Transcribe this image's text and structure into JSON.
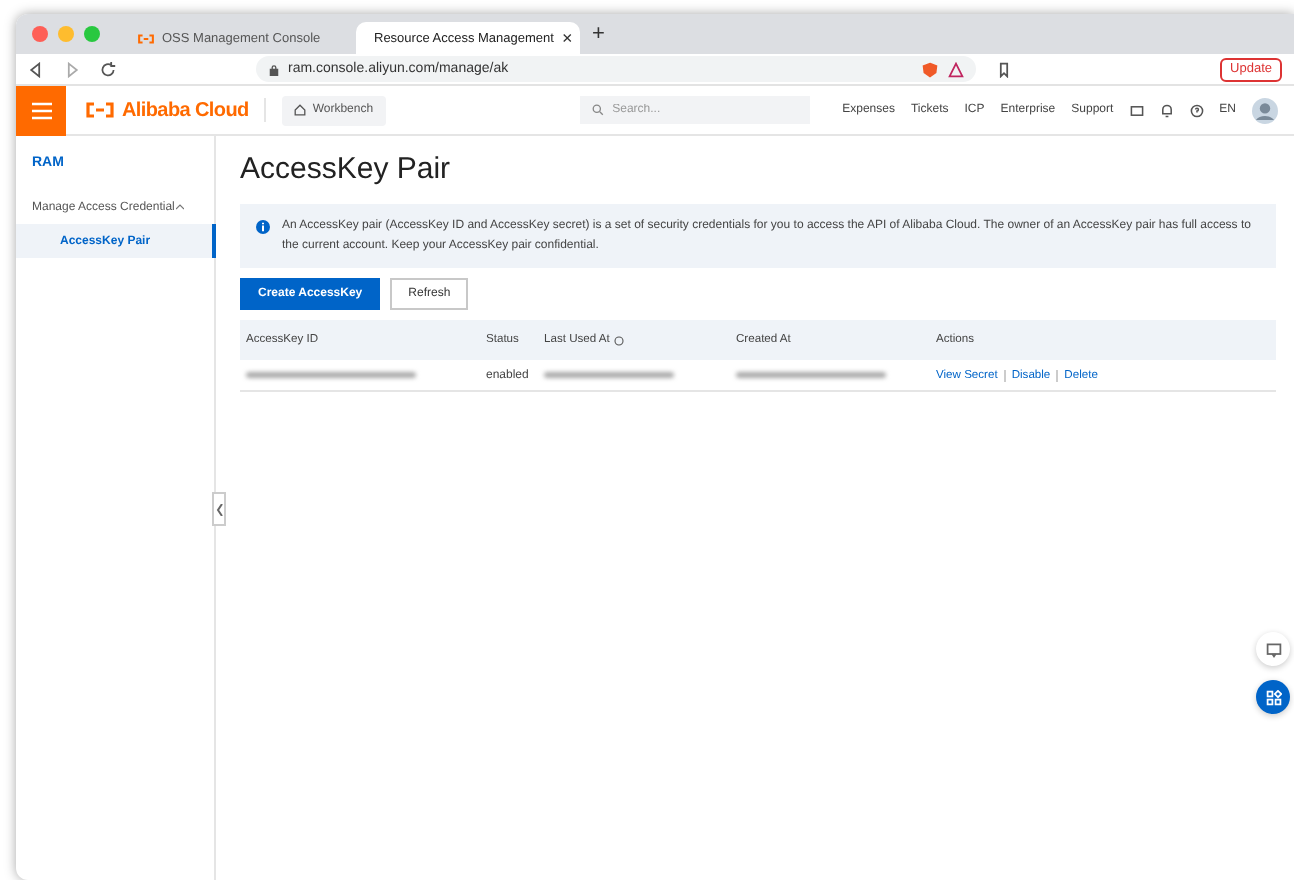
{
  "browser": {
    "tabs": [
      {
        "title": "OSS Management Console",
        "selected": false
      },
      {
        "title": "Resource Access Management",
        "selected": true,
        "close": "×"
      }
    ],
    "new_tab": "+",
    "address": "ram.console.aliyun.com/manage/ak",
    "update_button": "Update"
  },
  "header": {
    "logo": "Alibaba Cloud",
    "workbench": "Workbench",
    "search": {
      "placeholder": "Search..."
    },
    "links": [
      "Expenses",
      "Tickets",
      "ICP",
      "Enterprise",
      "Support"
    ],
    "language": "EN"
  },
  "sidebar": {
    "title": "RAM",
    "items": [
      {
        "label": "Manage Access Credential",
        "expanded": true,
        "children": [
          {
            "label": "AccessKey Pair",
            "selected": true
          }
        ]
      }
    ]
  },
  "page": {
    "title": "AccessKey Pair",
    "notice": "An AccessKey pair (AccessKey ID and AccessKey secret) is a set of security credentials for you to access the API of Alibaba Cloud. The owner of an AccessKey pair has full access to the current account. Keep your AccessKey pair confidential.",
    "buttons": [
      {
        "label": "Create AccessKey",
        "kind": "primary"
      },
      {
        "label": "Refresh",
        "kind": "default"
      }
    ]
  },
  "table": {
    "columns": [
      "AccessKey ID",
      "Status",
      "Last Used At",
      "Created At",
      "Actions"
    ],
    "rows": [
      {
        "status": "enabled",
        "actions": [
          "View Secret",
          "Disable",
          "Delete"
        ]
      }
    ]
  }
}
